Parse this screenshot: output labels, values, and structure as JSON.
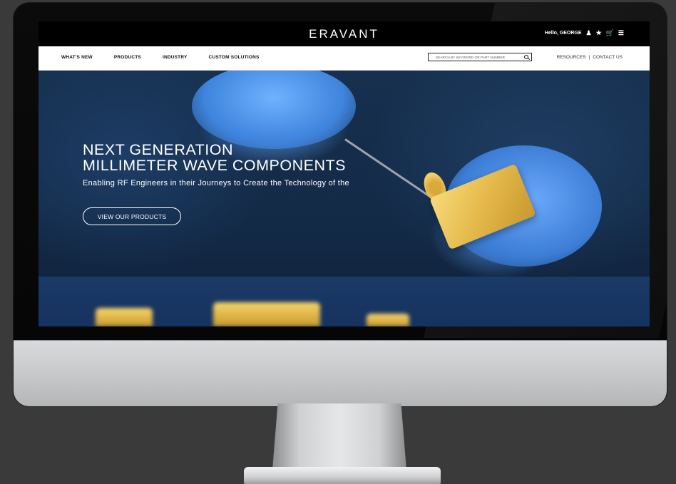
{
  "site": {
    "logo": "ERAVANT"
  },
  "topbar": {
    "greeting": "Hello, GEORGE"
  },
  "icons": {
    "user": "user-icon",
    "favorites": "star-icon",
    "cart": "cart-icon",
    "menu": "list-icon"
  },
  "nav": {
    "items": [
      "WHAT'S NEW",
      "PRODUCTS",
      "INDUSTRY",
      "CUSTOM SOLUTIONS"
    ]
  },
  "search": {
    "placeholder": "SEARCH BY KEYWORD OR PART NUMBER"
  },
  "util": {
    "resources": "RESOURCES",
    "separator": "|",
    "contact": "CONTACT US"
  },
  "hero": {
    "headline_line1": "NEXT GENERATION",
    "headline_line2": "MILLIMETER WAVE COMPONENTS",
    "subtitle": "Enabling RF Engineers in their Journeys to Create the Technology of the",
    "cta": "VIEW OUR PRODUCTS"
  },
  "colors": {
    "header_bg": "#000000",
    "nav_bg": "#ffffff",
    "hero_blue": "#17304f",
    "gold": "#e4b94a"
  }
}
